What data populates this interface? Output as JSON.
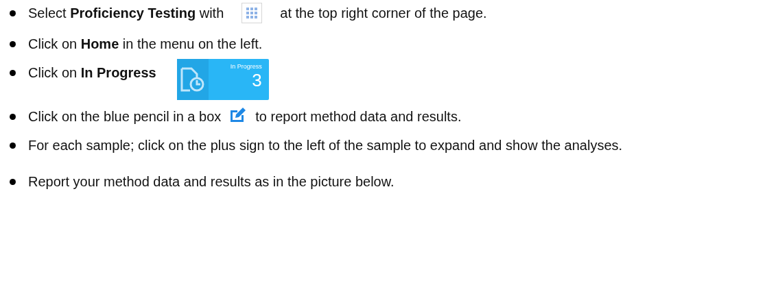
{
  "steps": [
    {
      "parts": [
        {
          "kind": "text",
          "text": "Select **Proficiency Testing** with"
        },
        {
          "kind": "grid_icon"
        },
        {
          "kind": "text",
          "text": "at the top right corner of the page."
        }
      ]
    },
    {
      "parts": [
        {
          "kind": "text",
          "text": "Click on **Home** in the menu on the left."
        }
      ]
    },
    {
      "parts": [
        {
          "kind": "text",
          "text": "Click on **In Progress**"
        },
        {
          "kind": "tile",
          "label": "In Progress",
          "count": "3"
        }
      ]
    },
    {
      "parts": [
        {
          "kind": "text",
          "text": "Click on the blue pencil in a box"
        },
        {
          "kind": "pencil_icon"
        },
        {
          "kind": "text",
          "text": "to report method data and results."
        }
      ]
    },
    {
      "parts": [
        {
          "kind": "text",
          "text": "For each sample; click on the plus sign to the left of the sample to expand and show the analyses."
        }
      ]
    },
    {
      "parts": [
        {
          "kind": "text",
          "text": "Report your method data and results as in the picture below."
        }
      ]
    }
  ]
}
